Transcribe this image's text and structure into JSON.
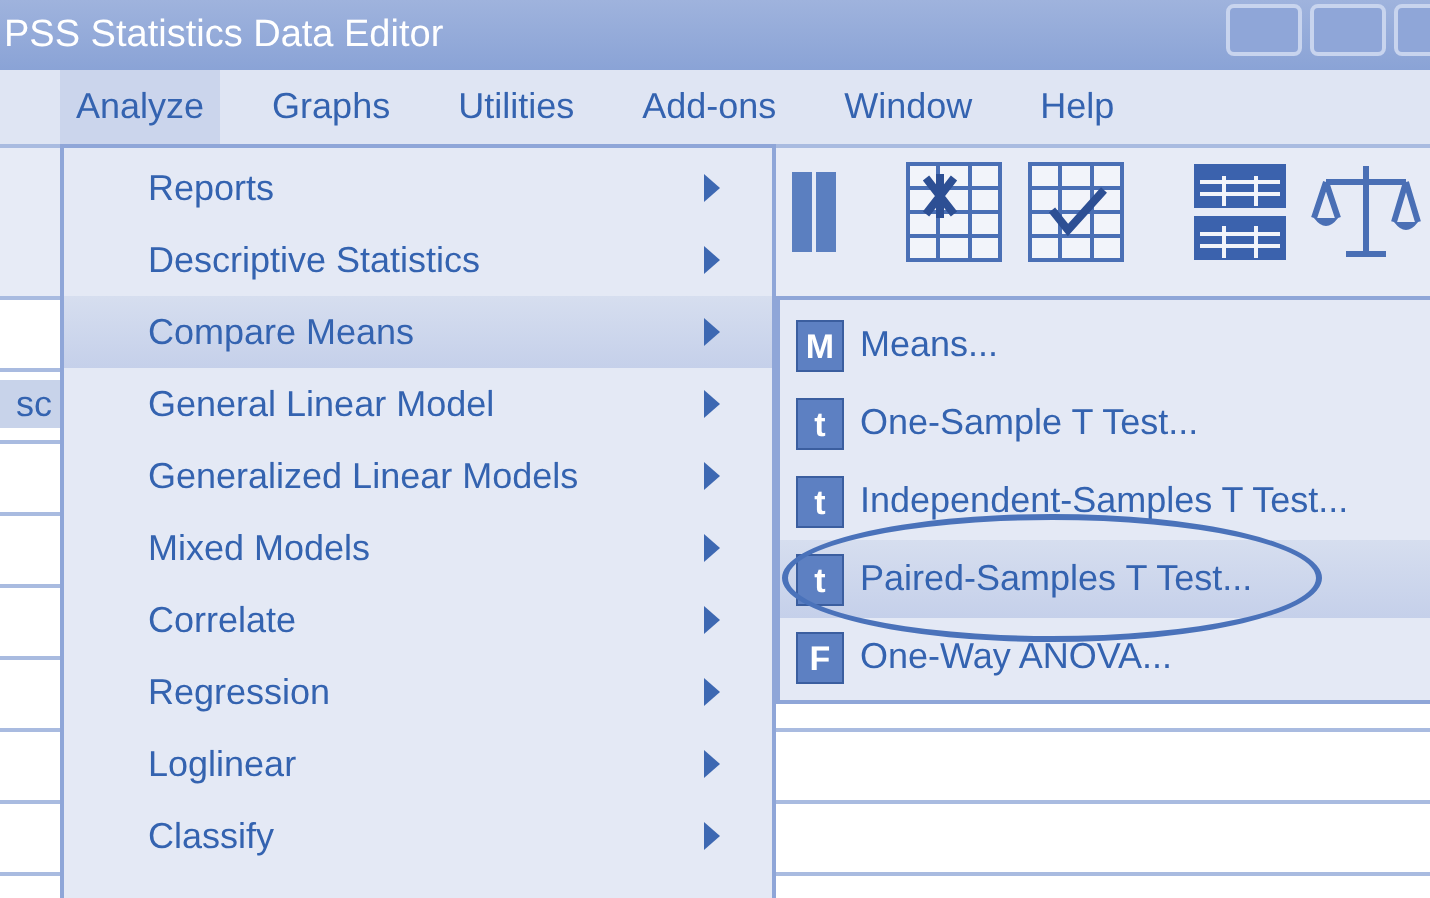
{
  "window": {
    "title": "PSS Statistics Data Editor"
  },
  "menu_bar": [
    {
      "label": "Analyze",
      "selected": true
    },
    {
      "label": "Graphs",
      "selected": false
    },
    {
      "label": "Utilities",
      "selected": false
    },
    {
      "label": "Add-ons",
      "selected": false
    },
    {
      "label": "Window",
      "selected": false
    },
    {
      "label": "Help",
      "selected": false
    }
  ],
  "data_grid": {
    "column_header": "sc"
  },
  "analyze_menu": [
    {
      "label": "Reports",
      "has_submenu": true,
      "selected": false
    },
    {
      "label": "Descriptive Statistics",
      "has_submenu": true,
      "selected": false
    },
    {
      "label": "Compare Means",
      "has_submenu": true,
      "selected": true
    },
    {
      "label": "General Linear Model",
      "has_submenu": true,
      "selected": false
    },
    {
      "label": "Generalized Linear Models",
      "has_submenu": true,
      "selected": false
    },
    {
      "label": "Mixed Models",
      "has_submenu": true,
      "selected": false
    },
    {
      "label": "Correlate",
      "has_submenu": true,
      "selected": false
    },
    {
      "label": "Regression",
      "has_submenu": true,
      "selected": false
    },
    {
      "label": "Loglinear",
      "has_submenu": true,
      "selected": false
    },
    {
      "label": "Classify",
      "has_submenu": true,
      "selected": false
    }
  ],
  "compare_means_submenu": [
    {
      "label": "Means...",
      "icon_text": "M",
      "selected": false,
      "circled": false
    },
    {
      "label": "One-Sample T Test...",
      "icon_text": "t",
      "selected": false,
      "circled": false
    },
    {
      "label": "Independent-Samples T Test...",
      "icon_text": "t",
      "selected": false,
      "circled": false
    },
    {
      "label": "Paired-Samples T Test...",
      "icon_text": "t",
      "selected": true,
      "circled": true
    },
    {
      "label": "One-Way ANOVA...",
      "icon_text": "F",
      "selected": false,
      "circled": false
    }
  ]
}
